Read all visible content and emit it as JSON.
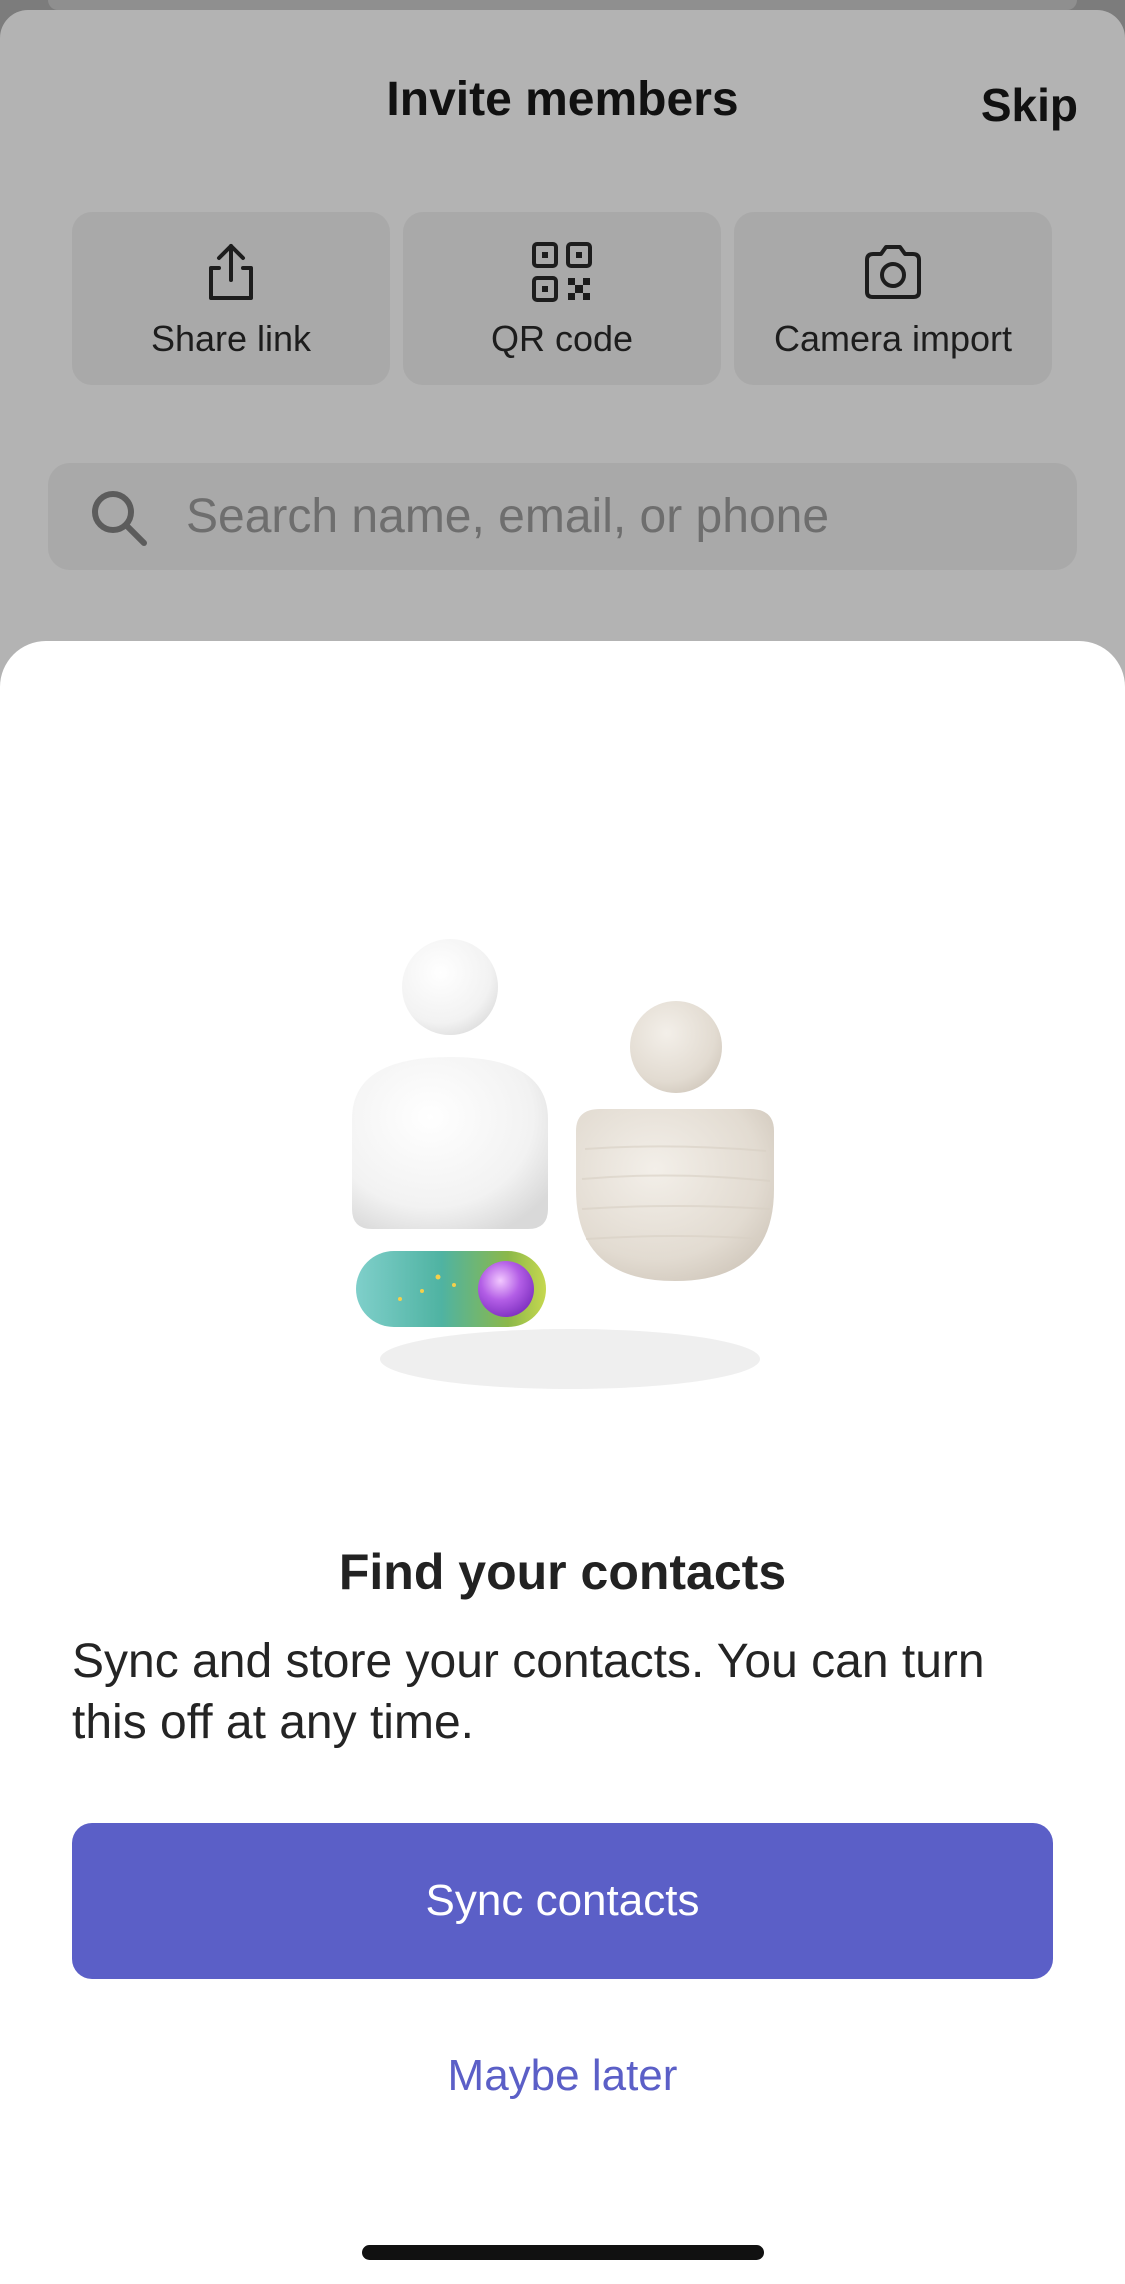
{
  "header": {
    "title": "Invite members",
    "skip_label": "Skip"
  },
  "invite_options": [
    {
      "label": "Share link",
      "icon": "share-icon"
    },
    {
      "label": "QR code",
      "icon": "qr-code-icon"
    },
    {
      "label": "Camera import",
      "icon": "camera-icon"
    }
  ],
  "search": {
    "placeholder": "Search name, email, or phone",
    "icon": "search-icon"
  },
  "modal": {
    "title": "Find your contacts",
    "description": "Sync and store your contacts. You can turn this off at any time.",
    "primary_label": "Sync contacts",
    "secondary_label": "Maybe later",
    "illustration": "contacts-sync-illustration"
  },
  "colors": {
    "accent": "#5b5fc7",
    "backdrop": "#b3b3b3",
    "sheet": "#ffffff"
  }
}
